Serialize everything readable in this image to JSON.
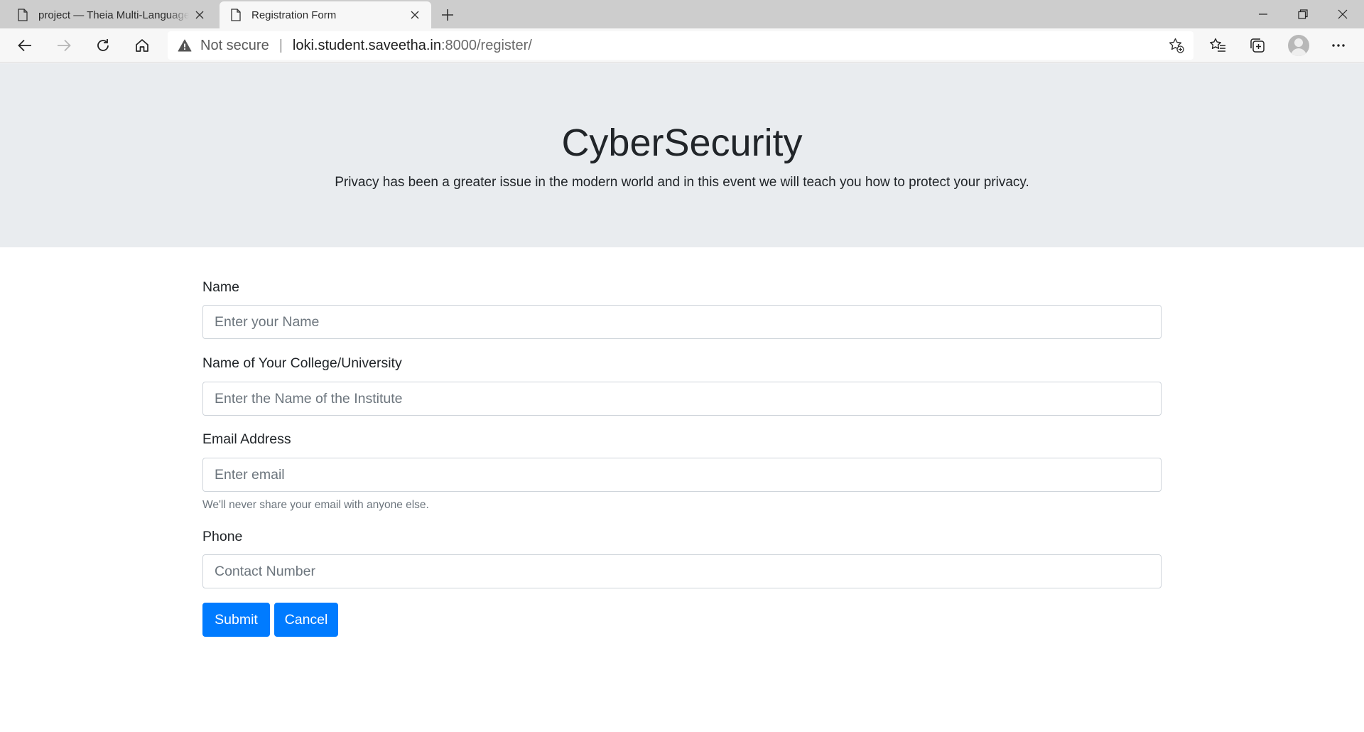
{
  "browser": {
    "tabs": [
      {
        "title": "project — Theia Multi-Language",
        "active": false
      },
      {
        "title": "Registration Form",
        "active": true
      }
    ],
    "address": {
      "security_label": "Not secure",
      "separator": "|",
      "host": "loki.student.saveetha.in",
      "path": ":8000/register/"
    },
    "icons": {
      "back": "back-arrow-icon",
      "forward": "forward-arrow-icon",
      "reload": "reload-icon",
      "home": "home-icon",
      "warning": "warning-icon",
      "add_favorite": "star-add-icon",
      "favorites": "favorites-icon",
      "collections": "collections-icon",
      "profile": "profile-avatar-icon",
      "more": "more-dots-icon"
    },
    "colors": {
      "tabstrip": "#cdcdcd",
      "toolbar": "#f7f7f7"
    }
  },
  "hero": {
    "title": "CyberSecurity",
    "subtitle": "Privacy has been a greater issue in the modern world and in this event we will teach you how to protect your privacy."
  },
  "form": {
    "name": {
      "label": "Name",
      "placeholder": "Enter your Name",
      "value": ""
    },
    "college": {
      "label": "Name of Your College/University",
      "placeholder": "Enter the Name of the Institute",
      "value": ""
    },
    "email": {
      "label": "Email Address",
      "placeholder": "Enter email",
      "value": "",
      "help": "We'll never share your email with anyone else."
    },
    "phone": {
      "label": "Phone",
      "placeholder": "Contact Number",
      "value": ""
    },
    "submit_label": "Submit",
    "cancel_label": "Cancel"
  },
  "theme": {
    "primary": "#007bff",
    "jumbotron_bg": "#e9ecef",
    "text": "#212529",
    "muted": "#6c757d"
  }
}
